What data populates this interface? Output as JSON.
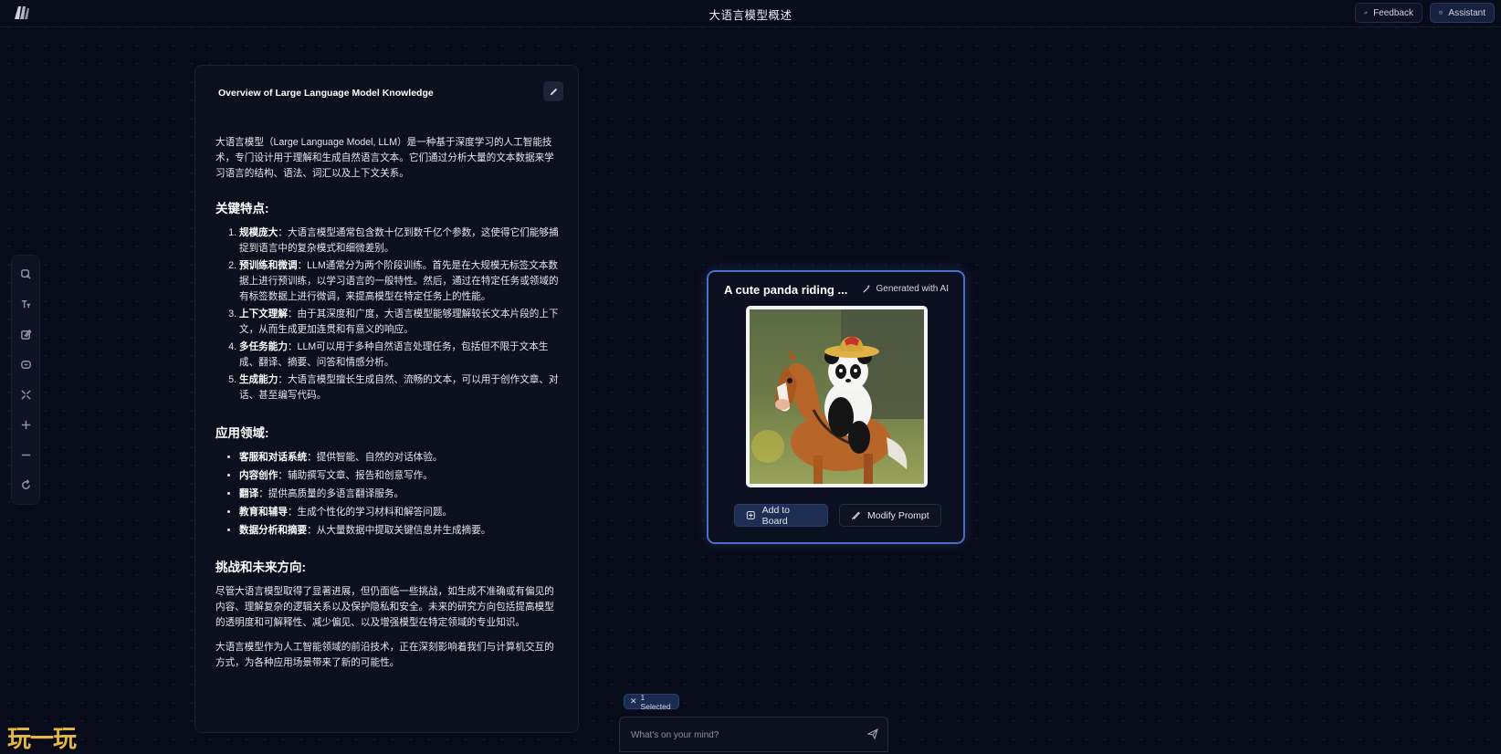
{
  "header": {
    "board_title": "大语言模型概述",
    "feedback_label": "Feedback",
    "assistant_label": "Assistant"
  },
  "toolbar": {
    "tools": [
      "select-icon",
      "text-icon",
      "note-icon",
      "chat-icon",
      "expand-icon",
      "zoom-in-icon",
      "zoom-out-icon",
      "reset-icon"
    ]
  },
  "document": {
    "title": "Overview of Large Language Model Knowledge",
    "intro": "大语言模型（Large Language Model, LLM）是一种基于深度学习的人工智能技术，专门设计用于理解和生成自然语言文本。它们通过分析大量的文本数据来学习语言的结构、语法、词汇以及上下文关系。",
    "features_heading": "关键特点:",
    "features": [
      {
        "term": "规模庞大",
        "text": "：大语言模型通常包含数十亿到数千亿个参数，这使得它们能够捕捉到语言中的复杂模式和细微差别。"
      },
      {
        "term": "预训练和微调",
        "text": "：LLM通常分为两个阶段训练。首先是在大规模无标签文本数据上进行预训练，以学习语言的一般特性。然后，通过在特定任务或领域的有标签数据上进行微调，来提高模型在特定任务上的性能。"
      },
      {
        "term": "上下文理解",
        "text": "：由于其深度和广度，大语言模型能够理解较长文本片段的上下文，从而生成更加连贯和有意义的响应。"
      },
      {
        "term": "多任务能力",
        "text": "：LLM可以用于多种自然语言处理任务，包括但不限于文本生成、翻译、摘要、问答和情感分析。"
      },
      {
        "term": "生成能力",
        "text": "：大语言模型擅长生成自然、流畅的文本，可以用于创作文章、对话、甚至编写代码。"
      }
    ],
    "apps_heading": "应用领域:",
    "apps": [
      {
        "term": "客服和对话系统",
        "text": "：提供智能、自然的对话体验。"
      },
      {
        "term": "内容创作",
        "text": "：辅助撰写文章、报告和创意写作。"
      },
      {
        "term": "翻译",
        "text": "：提供高质量的多语言翻译服务。"
      },
      {
        "term": "教育和辅导",
        "text": "：生成个性化的学习材料和解答问题。"
      },
      {
        "term": "数据分析和摘要",
        "text": "：从大量数据中提取关键信息并生成摘要。"
      }
    ],
    "challenges_heading": "挑战和未来方向:",
    "challenges": "尽管大语言模型取得了显著进展，但仍面临一些挑战，如生成不准确或有偏见的内容、理解复杂的逻辑关系以及保护隐私和安全。未来的研究方向包括提高模型的透明度和可解释性、减少偏见、以及增强模型在特定领域的专业知识。",
    "closing": "大语言模型作为人工智能领域的前沿技术，正在深刻影响着我们与计算机交互的方式，为各种应用场景带来了新的可能性。"
  },
  "image_card": {
    "title": "A cute panda riding ...",
    "generated_label": "Generated with AI",
    "add_label": "Add to Board",
    "modify_label": "Modify Prompt"
  },
  "chat": {
    "selected_label": "1 Selected",
    "placeholder": "What's on your mind?"
  },
  "watermark": "玩一玩",
  "colors": {
    "background": "#080c1a",
    "accent": "#4a6fc9",
    "watermark": "#e4b842"
  }
}
